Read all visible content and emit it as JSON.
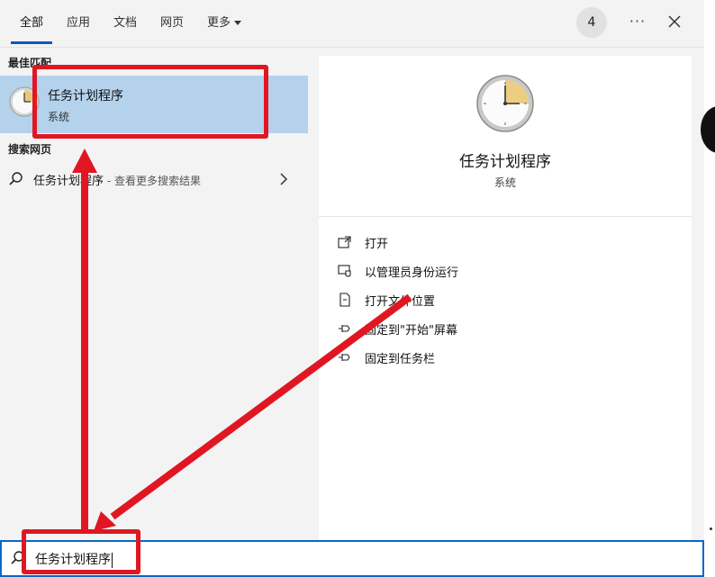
{
  "tabs": [
    {
      "label": "全部",
      "active": true
    },
    {
      "label": "应用",
      "active": false
    },
    {
      "label": "文档",
      "active": false
    },
    {
      "label": "网页",
      "active": false
    },
    {
      "label": "更多",
      "active": false,
      "dropdown": true
    }
  ],
  "header": {
    "count_badge": "4",
    "more_icon": "ellipsis-icon",
    "close_icon": "close-icon"
  },
  "best_match": {
    "section_label": "最佳匹配",
    "title": "任务计划程序",
    "subtitle": "系统",
    "icon": "clock-icon"
  },
  "web_search": {
    "section_label": "搜索网页",
    "query": "任务计划程序",
    "suffix": " - 查看更多搜索结果",
    "icon": "search-icon"
  },
  "detail": {
    "title": "任务计划程序",
    "subtitle": "系统",
    "actions": [
      {
        "label": "打开",
        "icon": "open-icon"
      },
      {
        "label": "以管理员身份运行",
        "icon": "run-as-admin-icon"
      },
      {
        "label": "打开文件位置",
        "icon": "file-location-icon"
      },
      {
        "label": "固定到\"开始\"屏幕",
        "icon": "pin-icon"
      },
      {
        "label": "固定到任务栏",
        "icon": "pin-icon"
      }
    ]
  },
  "search": {
    "value": "任务计划程序",
    "icon": "search-icon"
  },
  "colors": {
    "accent": "#0a68c9",
    "selection": "#b4d2ec",
    "annotation": "#e01722"
  }
}
